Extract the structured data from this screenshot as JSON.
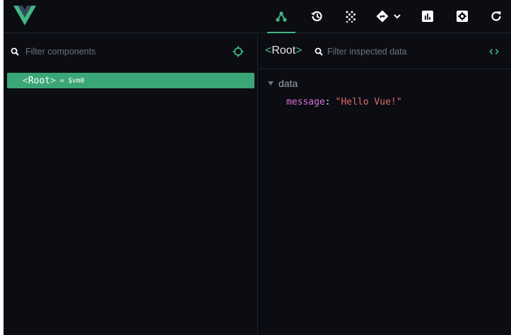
{
  "colors": {
    "accent": "#42b883",
    "selected_row": "#3ba776",
    "background": "#0b0d13",
    "prop_key": "#d670d6",
    "string_value": "#e06c6c"
  },
  "toolbar": {
    "items": [
      {
        "icon": "components-tree-icon",
        "active": true
      },
      {
        "icon": "timeline-history-icon",
        "active": false
      },
      {
        "icon": "vuex-dots-icon",
        "active": false
      },
      {
        "icon": "router-directions-icon",
        "dropdown": "chevron-down-icon",
        "active": false
      },
      {
        "icon": "performance-chart-icon",
        "active": false
      },
      {
        "icon": "settings-icon",
        "active": false
      },
      {
        "icon": "refresh-icon",
        "active": false
      }
    ]
  },
  "left_pane": {
    "filter_placeholder": "Filter components",
    "tree": [
      {
        "open_bracket": "<",
        "name": "Root",
        "close_bracket": ">",
        "vm": "= $vm0",
        "selected": true
      }
    ]
  },
  "right_pane": {
    "open_bracket": "<",
    "title": "Root",
    "close_bracket": ">",
    "filter_placeholder": "Filter inspected data",
    "sections": [
      {
        "name": "data",
        "props": [
          {
            "key": "message",
            "colon": ":",
            "value": "\"Hello Vue!\""
          }
        ]
      }
    ]
  }
}
